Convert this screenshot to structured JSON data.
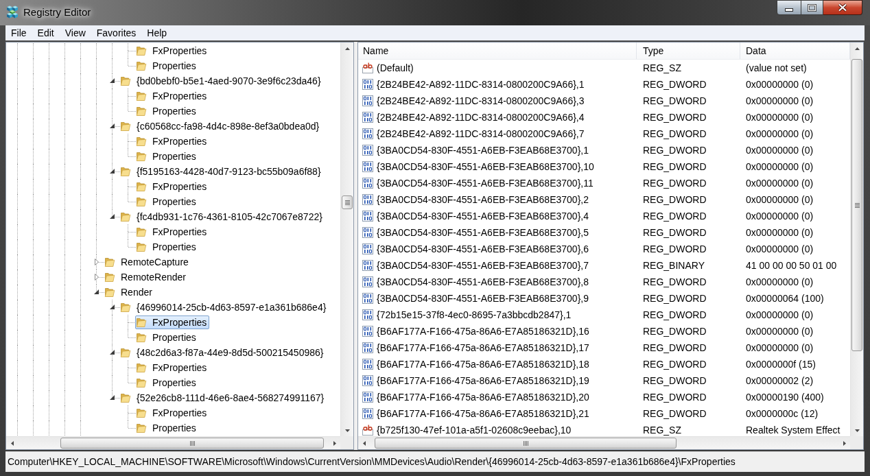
{
  "window": {
    "title": "Registry Editor"
  },
  "menu": [
    "File",
    "Edit",
    "View",
    "Favorites",
    "Help"
  ],
  "tree": {
    "items": [
      {
        "children": [
          {
            "children": [
              {
                "label": "FxProperties",
                "selected": false
              },
              {
                "label": "Properties",
                "selected": false
              }
            ]
          },
          {
            "label": "{bd0bebf0-b5e1-4aed-9070-3e9f6c23da46}",
            "expanded": true,
            "selected": false,
            "children": [
              {
                "label": "FxProperties",
                "selected": false
              },
              {
                "label": "Properties",
                "selected": false
              }
            ]
          },
          {
            "label": "{c60568cc-fa98-4d4c-898e-8ef3a0bdea0d}",
            "expanded": true,
            "selected": false,
            "children": [
              {
                "label": "FxProperties",
                "selected": false
              },
              {
                "label": "Properties",
                "selected": false
              }
            ]
          },
          {
            "label": "{f5195163-4428-40d7-9123-bc55b09a6f88}",
            "expanded": true,
            "selected": false,
            "children": [
              {
                "label": "FxProperties",
                "selected": false
              },
              {
                "label": "Properties",
                "selected": false
              }
            ]
          },
          {
            "label": "{fc4db931-1c76-4361-8105-42c7067e8722}",
            "expanded": true,
            "selected": false,
            "children": [
              {
                "label": "FxProperties",
                "selected": false
              },
              {
                "label": "Properties",
                "selected": false
              }
            ]
          }
        ]
      },
      {
        "label": "RemoteCapture",
        "expanded": false,
        "selected": false
      },
      {
        "label": "RemoteRender",
        "expanded": false,
        "selected": false
      },
      {
        "label": "Render",
        "expanded": true,
        "selected": false,
        "children": [
          {
            "label": "{46996014-25cb-4d63-8597-e1a361b686e4}",
            "expanded": true,
            "selected": false,
            "children": [
              {
                "label": "FxProperties",
                "selected": true
              },
              {
                "label": "Properties",
                "selected": false
              }
            ]
          },
          {
            "label": "{48c2d6a3-f87a-44e9-8d5d-500215450986}",
            "expanded": true,
            "selected": false,
            "children": [
              {
                "label": "FxProperties",
                "selected": false
              },
              {
                "label": "Properties",
                "selected": false
              }
            ]
          },
          {
            "label": "{52e26cb8-111d-46e6-8ae4-568274991167}",
            "expanded": true,
            "selected": false,
            "children": [
              {
                "label": "FxProperties",
                "selected": false
              },
              {
                "label": "Properties",
                "selected": false
              }
            ]
          }
        ]
      }
    ]
  },
  "list": {
    "columns": [
      "Name",
      "Type",
      "Data"
    ],
    "rows": [
      {
        "kind": "string",
        "name": "(Default)",
        "type": "REG_SZ",
        "data": "(value not set)",
        "selected": false
      },
      {
        "kind": "binary",
        "name": "{2B24BE42-A892-11DC-8314-0800200C9A66},1",
        "type": "REG_DWORD",
        "data": "0x00000000 (0)",
        "selected": false
      },
      {
        "kind": "binary",
        "name": "{2B24BE42-A892-11DC-8314-0800200C9A66},3",
        "type": "REG_DWORD",
        "data": "0x00000000 (0)",
        "selected": false
      },
      {
        "kind": "binary",
        "name": "{2B24BE42-A892-11DC-8314-0800200C9A66},4",
        "type": "REG_DWORD",
        "data": "0x00000000 (0)",
        "selected": false
      },
      {
        "kind": "binary",
        "name": "{2B24BE42-A892-11DC-8314-0800200C9A66},7",
        "type": "REG_DWORD",
        "data": "0x00000000 (0)",
        "selected": false
      },
      {
        "kind": "binary",
        "name": "{3BA0CD54-830F-4551-A6EB-F3EAB68E3700},1",
        "type": "REG_DWORD",
        "data": "0x00000000 (0)",
        "selected": false
      },
      {
        "kind": "binary",
        "name": "{3BA0CD54-830F-4551-A6EB-F3EAB68E3700},10",
        "type": "REG_DWORD",
        "data": "0x00000000 (0)",
        "selected": false
      },
      {
        "kind": "binary",
        "name": "{3BA0CD54-830F-4551-A6EB-F3EAB68E3700},11",
        "type": "REG_DWORD",
        "data": "0x00000000 (0)",
        "selected": false
      },
      {
        "kind": "binary",
        "name": "{3BA0CD54-830F-4551-A6EB-F3EAB68E3700},2",
        "type": "REG_DWORD",
        "data": "0x00000000 (0)",
        "selected": false
      },
      {
        "kind": "binary",
        "name": "{3BA0CD54-830F-4551-A6EB-F3EAB68E3700},4",
        "type": "REG_DWORD",
        "data": "0x00000000 (0)",
        "selected": false
      },
      {
        "kind": "binary",
        "name": "{3BA0CD54-830F-4551-A6EB-F3EAB68E3700},5",
        "type": "REG_DWORD",
        "data": "0x00000000 (0)",
        "selected": false
      },
      {
        "kind": "binary",
        "name": "{3BA0CD54-830F-4551-A6EB-F3EAB68E3700},6",
        "type": "REG_DWORD",
        "data": "0x00000000 (0)",
        "selected": false
      },
      {
        "kind": "binary",
        "name": "{3BA0CD54-830F-4551-A6EB-F3EAB68E3700},7",
        "type": "REG_BINARY",
        "data": "41 00 00 00 50 01 00",
        "selected": false
      },
      {
        "kind": "binary",
        "name": "{3BA0CD54-830F-4551-A6EB-F3EAB68E3700},8",
        "type": "REG_DWORD",
        "data": "0x00000000 (0)",
        "selected": false
      },
      {
        "kind": "binary",
        "name": "{3BA0CD54-830F-4551-A6EB-F3EAB68E3700},9",
        "type": "REG_DWORD",
        "data": "0x00000064 (100)",
        "selected": false
      },
      {
        "kind": "binary",
        "name": "{72b15e15-37f8-4ec0-8695-7a3bbcdb2847},1",
        "type": "REG_DWORD",
        "data": "0x00000000 (0)",
        "selected": false
      },
      {
        "kind": "binary",
        "name": "{B6AF177A-F166-475a-86A6-E7A85186321D},16",
        "type": "REG_DWORD",
        "data": "0x00000000 (0)",
        "selected": false
      },
      {
        "kind": "binary",
        "name": "{B6AF177A-F166-475a-86A6-E7A85186321D},17",
        "type": "REG_DWORD",
        "data": "0x00000000 (0)",
        "selected": false
      },
      {
        "kind": "binary",
        "name": "{B6AF177A-F166-475a-86A6-E7A85186321D},18",
        "type": "REG_DWORD",
        "data": "0x0000000f (15)",
        "selected": false
      },
      {
        "kind": "binary",
        "name": "{B6AF177A-F166-475a-86A6-E7A85186321D},19",
        "type": "REG_DWORD",
        "data": "0x00000002 (2)",
        "selected": false
      },
      {
        "kind": "binary",
        "name": "{B6AF177A-F166-475a-86A6-E7A85186321D},20",
        "type": "REG_DWORD",
        "data": "0x00000190 (400)",
        "selected": false
      },
      {
        "kind": "binary",
        "name": "{B6AF177A-F166-475a-86A6-E7A85186321D},21",
        "type": "REG_DWORD",
        "data": "0x0000000c (12)",
        "selected": false
      },
      {
        "kind": "string",
        "name": "{b725f130-47ef-101a-a5f1-02608c9eebac},10",
        "type": "REG_SZ",
        "data": "Realtek System Effect",
        "selected": false
      }
    ]
  },
  "status_bar": "Computer\\HKEY_LOCAL_MACHINE\\SOFTWARE\\Microsoft\\Windows\\CurrentVersion\\MMDevices\\Audio\\Render\\{46996014-25cb-4d63-8597-e1a361b686e4}\\FxProperties"
}
